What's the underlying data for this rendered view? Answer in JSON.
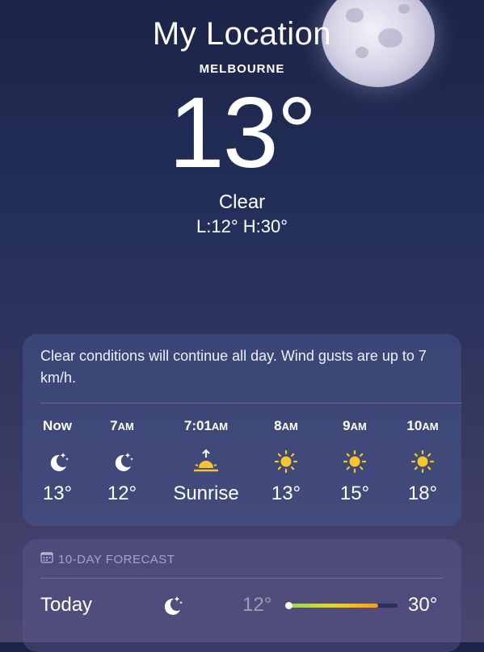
{
  "location": {
    "title": "My Location",
    "city": "MELBOURNE",
    "temperature": "13°",
    "condition": "Clear",
    "low_high": "L:12° H:30°"
  },
  "hourly": {
    "summary": "Clear conditions will continue all day. Wind gusts are up to 7 km/h.",
    "items": [
      {
        "time": "Now",
        "suffix": "",
        "icon": "moon-stars-icon",
        "value": "13°"
      },
      {
        "time": "7",
        "suffix": "AM",
        "icon": "moon-stars-icon",
        "value": "12°"
      },
      {
        "time": "7:01",
        "suffix": "AM",
        "icon": "sunrise-icon",
        "value": "Sunrise"
      },
      {
        "time": "8",
        "suffix": "AM",
        "icon": "sun-icon",
        "value": "13°"
      },
      {
        "time": "9",
        "suffix": "AM",
        "icon": "sun-icon",
        "value": "15°"
      },
      {
        "time": "10",
        "suffix": "AM",
        "icon": "sun-icon",
        "value": "18°"
      }
    ]
  },
  "forecast": {
    "header": "10-DAY FORECAST",
    "rows": [
      {
        "day": "Today",
        "icon": "moon-stars-icon",
        "low": "12°",
        "high": "30°",
        "range_fraction": 0.82
      }
    ]
  },
  "colors": {
    "sun": "#f7c52a",
    "range_start": "#8fd66a",
    "range_end": "#f59a27"
  }
}
